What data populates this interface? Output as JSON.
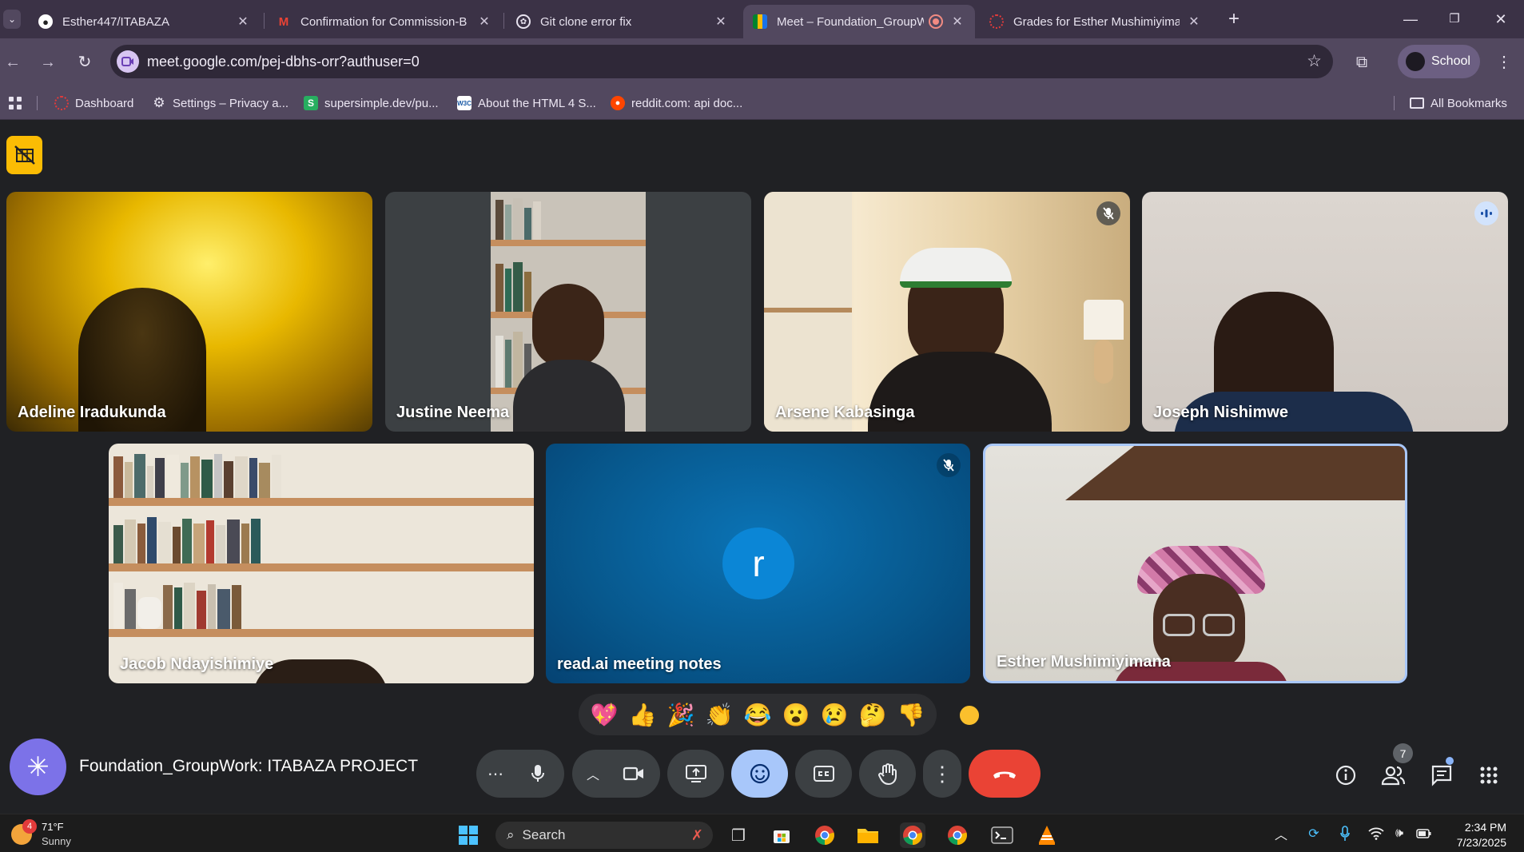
{
  "browser": {
    "tabs": [
      {
        "title": "Esther447/ITABAZA",
        "icon": "github-icon"
      },
      {
        "title": "Confirmation for Commission-B",
        "icon": "gmail-icon"
      },
      {
        "title": "Git clone error fix",
        "icon": "chatgpt-icon"
      },
      {
        "title": "Meet – Foundation_GroupW",
        "icon": "google-meet-icon",
        "active": true
      },
      {
        "title": "Grades for Esther Mushimiyima",
        "icon": "canvas-icon"
      }
    ],
    "url": "meet.google.com/pej-dbhs-orr?authuser=0",
    "profile_label": "School",
    "bookmarks": [
      {
        "label": "Dashboard",
        "icon": "canvas-icon"
      },
      {
        "label": "Settings – Privacy a...",
        "icon": "gear-icon"
      },
      {
        "label": "supersimple.dev/pu...",
        "icon": "supersimple-icon"
      },
      {
        "label": "About the HTML 4 S...",
        "icon": "w3c-icon"
      },
      {
        "label": "reddit.com: api doc...",
        "icon": "reddit-icon"
      }
    ],
    "all_bookmarks_label": "All Bookmarks"
  },
  "meet": {
    "participants": [
      {
        "name": "Adeline Iradukunda"
      },
      {
        "name": "Justine Neema"
      },
      {
        "name": "Arsene Kabasinga",
        "muted": true
      },
      {
        "name": "Joseph Nishimwe",
        "speaking": true
      },
      {
        "name": "Jacob Ndayishimiye"
      },
      {
        "name": "read.ai meeting notes",
        "avatar_letter": "r",
        "muted": true
      },
      {
        "name": "Esther Mushimiyimana",
        "self": true
      }
    ],
    "reactions": [
      "💖",
      "👍",
      "🎉",
      "👏",
      "😂",
      "😮",
      "😢",
      "🤔",
      "👎"
    ],
    "meeting_title": "Foundation_GroupWork: ITABAZA PROJECT",
    "people_count": "7",
    "accent_color": "#a8c7fa",
    "end_call_color": "#ea4335"
  },
  "taskbar": {
    "weather_badge": "4",
    "weather_temp": "71°F",
    "weather_desc": "Sunny",
    "search_placeholder": "Search",
    "time": "2:34 PM",
    "date": "7/23/2025"
  }
}
